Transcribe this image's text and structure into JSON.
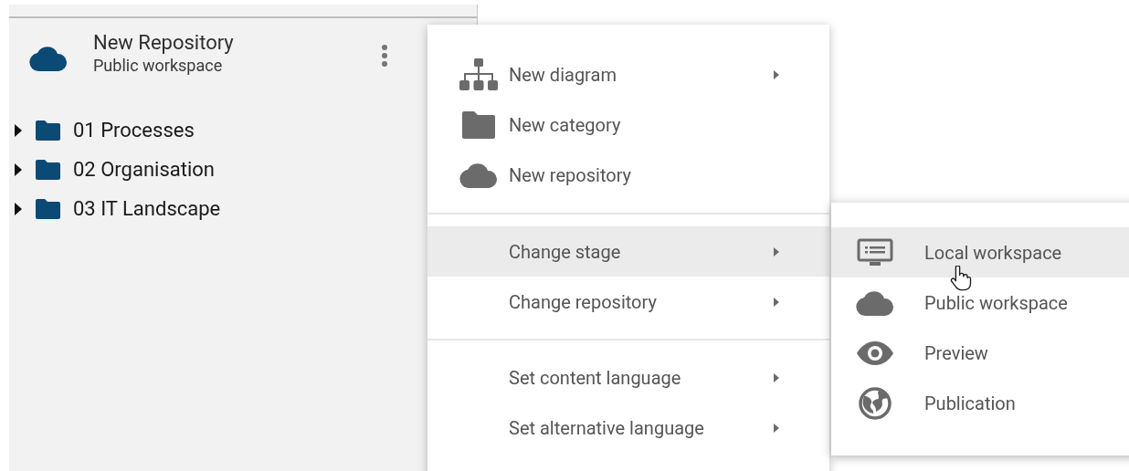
{
  "repository": {
    "title": "New Repository",
    "subtitle": "Public workspace"
  },
  "tree": [
    {
      "label": "01 Processes",
      "expanded": false
    },
    {
      "label": "02 Organisation",
      "expanded": false
    },
    {
      "label": "03 IT Landscape",
      "expanded": false
    }
  ],
  "menu": {
    "groups": [
      [
        {
          "label": "New diagram",
          "kind": "diagram",
          "has_submenu": true,
          "selected": false
        },
        {
          "label": "New category",
          "kind": "folder",
          "has_submenu": false,
          "selected": false
        },
        {
          "label": "New repository",
          "kind": "cloud",
          "has_submenu": false,
          "selected": false
        }
      ],
      [
        {
          "label": "Change stage",
          "has_submenu": true,
          "selected": true
        },
        {
          "label": "Change repository",
          "has_submenu": true,
          "selected": false
        }
      ],
      [
        {
          "label": "Set content language",
          "has_submenu": true,
          "selected": false
        },
        {
          "label": "Set alternative language",
          "has_submenu": true,
          "selected": false
        }
      ]
    ]
  },
  "submenu": {
    "items": [
      {
        "label": "Local workspace",
        "kind": "monitor",
        "selected": true
      },
      {
        "label": "Public workspace",
        "kind": "cloud",
        "selected": false
      },
      {
        "label": "Preview",
        "kind": "eye",
        "selected": false
      },
      {
        "label": "Publication",
        "kind": "globe",
        "selected": false
      }
    ]
  }
}
